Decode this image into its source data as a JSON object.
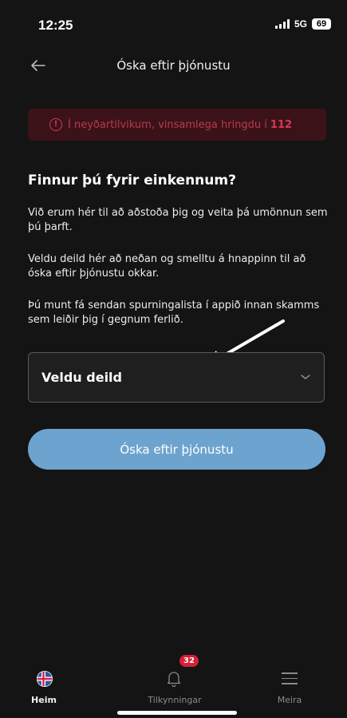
{
  "status": {
    "time": "12:25",
    "network": "5G",
    "battery": "69"
  },
  "nav": {
    "title": "Óska eftir þjónustu"
  },
  "emergency": {
    "text": "Í neyðartilvikum, vinsamlega hringdu í",
    "number": "112"
  },
  "content": {
    "heading": "Finnur þú fyrir einkennum?",
    "p1": "Við erum hér til að aðstoða þig og veita þá umönnun sem þú þarft.",
    "p2": "Veldu deild hér að neðan og smelltu á hnappinn til að óska eftir þjónustu okkar.",
    "p3": "Þú munt fá sendan spurningalista í appið innan skamms sem leiðir þig í gegnum ferlið."
  },
  "select": {
    "label": "Veldu deild"
  },
  "cta": {
    "label": "Óska eftir þjónustu"
  },
  "tabs": {
    "home": "Heim",
    "notifications": "Tilkynningar",
    "notifications_badge": "32",
    "more": "Meira"
  },
  "colors": {
    "accent_button": "#6da3cf",
    "emergency_bg": "#3c1219",
    "emergency_text": "#b83a4c",
    "badge": "#d6203a"
  }
}
